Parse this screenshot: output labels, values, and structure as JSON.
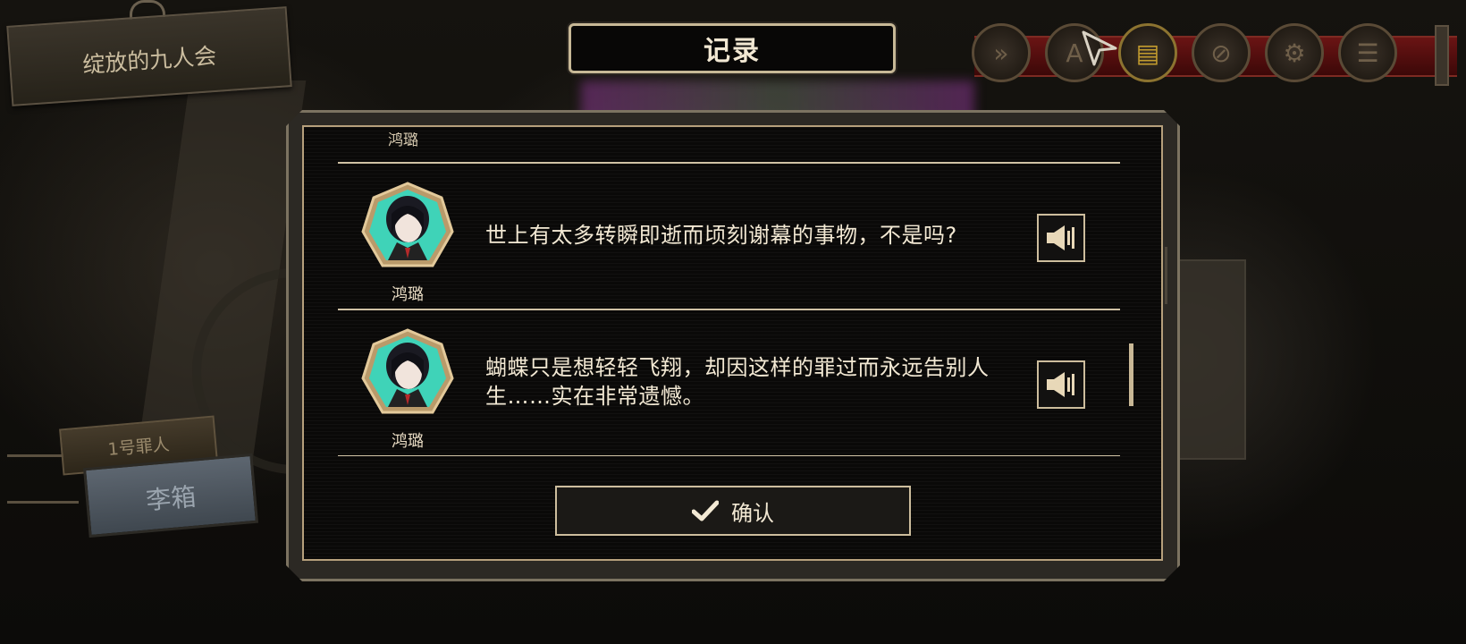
{
  "scene": {
    "chapter_title": "绽放的九人会",
    "character_tag": "1号罪人",
    "character_name": "李箱"
  },
  "toolbar": {
    "buttons": [
      {
        "name": "fast-forward",
        "icon": "fast-forward-icon",
        "glyph": "»"
      },
      {
        "name": "auto",
        "icon": "auto-icon",
        "glyph": "A"
      },
      {
        "name": "log",
        "icon": "log-icon",
        "glyph": "▤",
        "active": true
      },
      {
        "name": "hide-ui",
        "icon": "eye-off-icon",
        "glyph": "⊘"
      },
      {
        "name": "settings",
        "icon": "gear-icon",
        "glyph": "⚙"
      },
      {
        "name": "menu",
        "icon": "menu-icon",
        "glyph": "☰"
      }
    ]
  },
  "log": {
    "title": "记录",
    "cut_off_name": "鸿璐",
    "entries": [
      {
        "speaker": "鸿璐",
        "text": "世上有太多转瞬即逝而顷刻谢幕的事物，不是吗?",
        "avatar": "character-portrait"
      },
      {
        "speaker": "鸿璐",
        "text": "蝴蝶只是想轻轻飞翔，却因这样的罪过而永远告别人生……实在非常遗憾。",
        "avatar": "character-portrait"
      }
    ],
    "confirm_label": "确认"
  },
  "colors": {
    "accent": "#cdbd9d",
    "avatar_bg": "#3fd3b8",
    "panel_bg": "#0a0908",
    "active_icon": "#c29b2e"
  }
}
